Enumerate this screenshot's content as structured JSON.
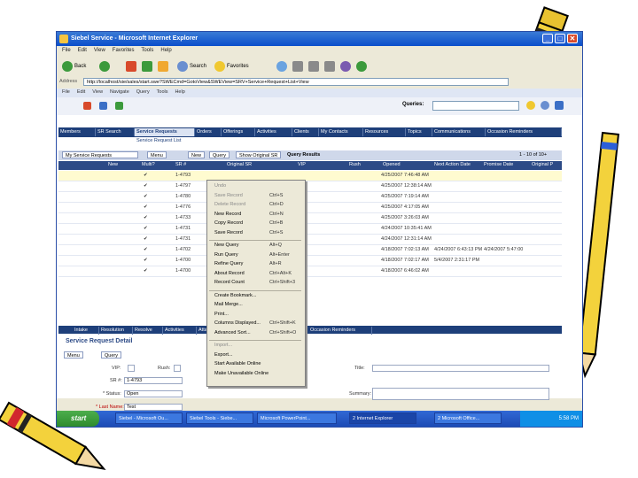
{
  "window": {
    "title": "Siebel Service - Microsoft Internet Explorer",
    "btn_min": "_",
    "btn_max": "□",
    "btn_close": "✕"
  },
  "ie_menu": [
    "File",
    "Edit",
    "View",
    "Favorites",
    "Tools",
    "Help"
  ],
  "ie_toolbar": {
    "back": "Back",
    "search": "Search",
    "favorites": "Favorites"
  },
  "address": {
    "label": "Address",
    "value": "http://localhost/sie/sales/start.swe?SWECmd=GotoView&SWEView=SRV+Service+Request+List+View"
  },
  "app_menu": [
    "File",
    "Edit",
    "View",
    "Navigate",
    "Query",
    "Tools",
    "Help"
  ],
  "queries_label": "Queries:",
  "tabs": [
    "Members",
    "SR Search",
    "Service Requests",
    "Orders",
    "Offerings",
    "Activities",
    "Clients",
    "My Contacts",
    "Resources",
    "Topics",
    "Communications",
    "Occasion Reminders"
  ],
  "subtitle": "Service Request List",
  "list_buttons": {
    "view_select": "My Service Requests",
    "menu": "Menu",
    "new": "New",
    "query": "Query",
    "show_original": "Show Original SR",
    "query_results": "Query Results",
    "record_count": "1 - 10 of 10+"
  },
  "columns": [
    "New",
    "Multi?",
    "SR #",
    "Original SR",
    "VIP",
    "Rush",
    "Opened",
    "Next Action Date",
    "Promise Date",
    "Original P"
  ],
  "rows": [
    {
      "sr": "1-4793",
      "opened": "4/25/2007 7:46:48 AM",
      "next": "",
      "promise": ""
    },
    {
      "sr": "1-4797",
      "opened": "4/25/2007 12:38:14 AM",
      "next": "",
      "promise": ""
    },
    {
      "sr": "1-4780",
      "opened": "4/25/2007 7:19:14 AM",
      "next": "",
      "promise": ""
    },
    {
      "sr": "1-4776",
      "opened": "4/25/2007 4:17:05 AM",
      "next": "",
      "promise": ""
    },
    {
      "sr": "1-4733",
      "opened": "4/25/2007 3:26:03 AM",
      "next": "",
      "promise": ""
    },
    {
      "sr": "1-4731",
      "opened": "4/24/2007 10:35:41 AM",
      "next": "",
      "promise": ""
    },
    {
      "sr": "1-4731",
      "opened": "4/24/2007 12:31:14 AM",
      "next": "",
      "promise": ""
    },
    {
      "sr": "1-4702",
      "opened": "4/18/2007 7:02:13 AM",
      "next": "4/24/2007 6:43:13 PM",
      "promise": "4/24/2007 5:47:00"
    },
    {
      "sr": "1-4700",
      "opened": "4/18/2007 7:02:17 AM",
      "next": "5/4/2007 2:31:17 PM",
      "promise": ""
    },
    {
      "sr": "1-4700",
      "opened": "4/18/2007 6:46:02 AM",
      "next": "",
      "promise": ""
    }
  ],
  "context_menu": [
    {
      "label": "Undo",
      "shortcut": "",
      "disabled": true
    },
    {
      "label": "Save Record",
      "shortcut": "Ctrl+S",
      "disabled": true
    },
    {
      "label": "Delete Record",
      "shortcut": "Ctrl+D",
      "disabled": true
    },
    {
      "label": "New Record",
      "shortcut": "Ctrl+N",
      "disabled": false
    },
    {
      "label": "Copy Record",
      "shortcut": "Ctrl+B",
      "disabled": false
    },
    {
      "label": "Save Record",
      "shortcut": "Ctrl+S",
      "disabled": false
    },
    {
      "label": "New Query",
      "shortcut": "Alt+Q",
      "disabled": false
    },
    {
      "label": "Run Query",
      "shortcut": "Alt+Enter",
      "disabled": false
    },
    {
      "label": "Refine Query",
      "shortcut": "Alt+R",
      "disabled": false
    },
    {
      "label": "About Record",
      "shortcut": "Ctrl+Alt+K",
      "disabled": false
    },
    {
      "label": "Record Count",
      "shortcut": "Ctrl+Shift+3",
      "disabled": false
    },
    {
      "label": "Create Bookmark...",
      "shortcut": "",
      "disabled": false
    },
    {
      "label": "Mail Merge...",
      "shortcut": "",
      "disabled": false
    },
    {
      "label": "Print...",
      "shortcut": "",
      "disabled": false
    },
    {
      "label": "Columns Displayed...",
      "shortcut": "Ctrl+Shift+K",
      "disabled": false
    },
    {
      "label": "Advanced Sort...",
      "shortcut": "Ctrl+Shift+O",
      "disabled": false
    },
    {
      "label": "Import...",
      "shortcut": "",
      "disabled": true
    },
    {
      "label": "Export...",
      "shortcut": "",
      "disabled": false
    },
    {
      "label": "Start Available Online",
      "shortcut": "",
      "disabled": false
    },
    {
      "label": "Make Unavailable Online",
      "shortcut": "",
      "disabled": false
    }
  ],
  "form_tabs": [
    "Intake",
    "Resolution",
    "Resolve",
    "Activities",
    "Attachments",
    "Occasion Reminders"
  ],
  "form": {
    "title": "Service Request Detail",
    "menu": "Menu",
    "query": "Query",
    "vip_label": "VIP:",
    "rush_label": "Rush:",
    "sr_label": "SR #:",
    "sr_value": "1-4793",
    "status_label": "* Status:",
    "status_value": "Open",
    "last_name_label": "* Last Name:",
    "last_name_value": "Test",
    "title_label": "Title:",
    "summary_label": "Summary:"
  },
  "taskbar": {
    "start": "start",
    "tasks": [
      "Siebel - Microsoft Ou...",
      "Siebel Tools - Siebe...",
      "Microsoft PowerPoint...",
      "2 Internet Explorer",
      "2 Microsoft Office..."
    ],
    "tray": "5:58 PM"
  }
}
